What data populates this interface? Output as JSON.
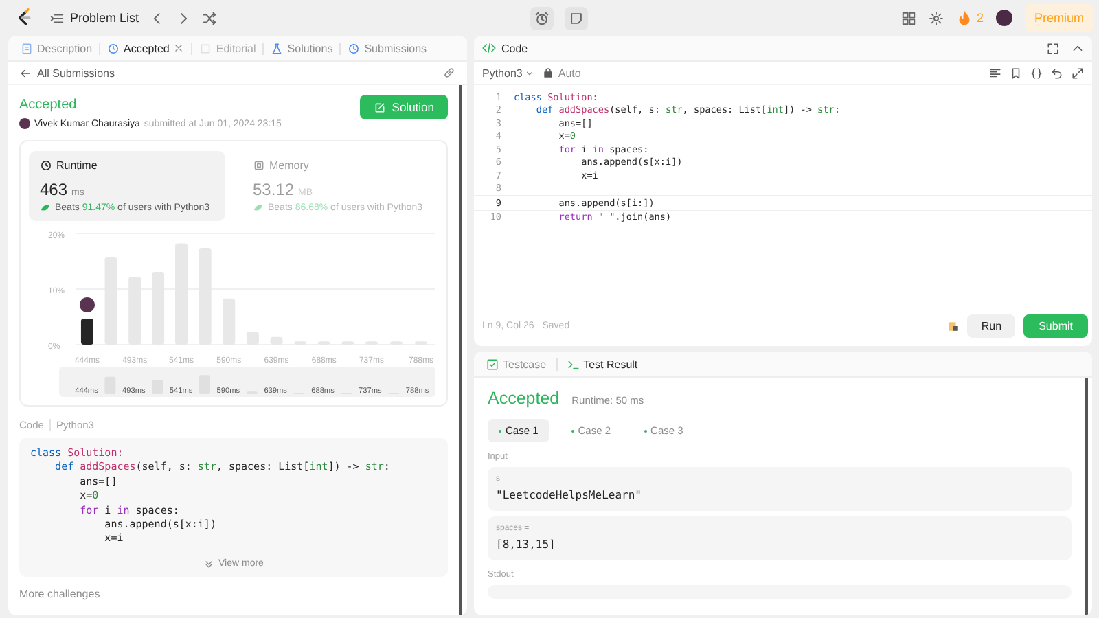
{
  "topbar": {
    "title": "Problem List",
    "streak": "2",
    "premium": "Premium"
  },
  "left_tabs": [
    {
      "label": "Description",
      "kind": "description",
      "selected": false,
      "disabled": false,
      "closable": false
    },
    {
      "label": "Accepted",
      "kind": "accepted",
      "selected": true,
      "disabled": false,
      "closable": true
    },
    {
      "label": "Editorial",
      "kind": "editorial",
      "selected": false,
      "disabled": true,
      "closable": false
    },
    {
      "label": "Solutions",
      "kind": "solutions",
      "selected": false,
      "disabled": false,
      "closable": false
    },
    {
      "label": "Submissions",
      "kind": "submissions",
      "selected": false,
      "disabled": false,
      "closable": false
    }
  ],
  "back_link": "All Submissions",
  "submission": {
    "status": "Accepted",
    "author": "Vivek Kumar Chaurasiya",
    "submitted": "submitted at Jun 01, 2024 23:15",
    "solution_button": "Solution"
  },
  "metrics": [
    {
      "kind": "runtime",
      "label": "Runtime",
      "value": "463",
      "unit": "ms",
      "beats_label": "Beats",
      "beats": "91.47%",
      "beats_suffix": "of users with Python3",
      "selected": true
    },
    {
      "kind": "memory",
      "label": "Memory",
      "value": "53.12",
      "unit": "MB",
      "beats_label": "Beats",
      "beats": "86.68%",
      "beats_suffix": "of users with Python3",
      "selected": false
    }
  ],
  "chart_data": {
    "type": "bar",
    "x": [
      444,
      468.5,
      493,
      517,
      541,
      565.5,
      590,
      614.5,
      639,
      663.5,
      688,
      712.5,
      737,
      762.5,
      788
    ],
    "xlim": [
      432,
      800
    ],
    "ylim": [
      0,
      20
    ],
    "yticks": [
      {
        "value": 0,
        "label": "0%"
      },
      {
        "value": 10,
        "label": "10%"
      },
      {
        "value": 20,
        "label": "20%"
      }
    ],
    "xticks": [
      {
        "value": 444,
        "label": "444ms"
      },
      {
        "value": 493,
        "label": "493ms"
      },
      {
        "value": 541,
        "label": "541ms"
      },
      {
        "value": 590,
        "label": "590ms"
      },
      {
        "value": 639,
        "label": "639ms"
      },
      {
        "value": 688,
        "label": "688ms"
      },
      {
        "value": 737,
        "label": "737ms"
      },
      {
        "value": 788,
        "label": "788ms"
      }
    ],
    "series": [
      {
        "color": "#262626",
        "values": [
          4.7,
          null,
          null,
          null,
          null,
          null,
          null,
          null,
          null,
          null,
          null,
          null,
          null,
          null,
          null
        ]
      },
      {
        "color": "#e8e8e8",
        "values": [
          null,
          15.8,
          12.2,
          13.1,
          18.2,
          17.4,
          8.3,
          2.3,
          1.4,
          0.6,
          0.6,
          0.6,
          0.6,
          0.6,
          0.6
        ]
      }
    ]
  },
  "overview_labels": [
    "444ms",
    "493ms",
    "541ms",
    "590ms",
    "639ms",
    "688ms",
    "737ms",
    "788ms"
  ],
  "code_preview": {
    "label": "Code",
    "language": "Python3",
    "view_more": "View more",
    "lines": [
      [
        {
          "text": "class ",
          "kind": "kw"
        },
        {
          "text": "Solution:",
          "kind": "name"
        }
      ],
      [
        {
          "text": "    def ",
          "kind": "kw"
        },
        {
          "text": "addSpaces",
          "kind": "name"
        },
        {
          "text": "(self, s: ",
          "kind": "plain"
        },
        {
          "text": "str",
          "kind": "type"
        },
        {
          "text": ", spaces: List[",
          "kind": "plain"
        },
        {
          "text": "int",
          "kind": "type"
        },
        {
          "text": "]) -> ",
          "kind": "plain"
        },
        {
          "text": "str",
          "kind": "type"
        },
        {
          "text": ":",
          "kind": "plain"
        }
      ],
      [
        {
          "text": "        ans=[]",
          "kind": "plain"
        }
      ],
      [
        {
          "text": "        x=",
          "kind": "plain"
        },
        {
          "text": "0",
          "kind": "num"
        }
      ],
      [
        {
          "text": "        for",
          "kind": "ctrl"
        },
        {
          "text": " i ",
          "kind": "plain"
        },
        {
          "text": "in",
          "kind": "ctrl"
        },
        {
          "text": " spaces:",
          "kind": "plain"
        }
      ],
      [
        {
          "text": "            ans.append(s[x:i])",
          "kind": "plain"
        }
      ],
      [
        {
          "text": "            x=i",
          "kind": "plain"
        }
      ]
    ]
  },
  "more_challenges": "More challenges",
  "editor": {
    "title": "Code",
    "language": "Python3",
    "mode": "Auto",
    "cursor": "Ln 9, Col 26",
    "saved": "Saved",
    "run": "Run",
    "submit": "Submit",
    "lines": [
      {
        "number": "1",
        "current": false,
        "tokens": [
          {
            "text": "class ",
            "kind": "kw"
          },
          {
            "text": "Solution:",
            "kind": "name"
          }
        ]
      },
      {
        "number": "2",
        "current": false,
        "tokens": [
          {
            "text": "    def ",
            "kind": "kw"
          },
          {
            "text": "addSpaces",
            "kind": "name"
          },
          {
            "text": "(self, s: ",
            "kind": "plain"
          },
          {
            "text": "str",
            "kind": "type"
          },
          {
            "text": ", spaces: List[",
            "kind": "plain"
          },
          {
            "text": "int",
            "kind": "type"
          },
          {
            "text": "]) -> ",
            "kind": "plain"
          },
          {
            "text": "str",
            "kind": "type"
          },
          {
            "text": ":",
            "kind": "plain"
          }
        ]
      },
      {
        "number": "3",
        "current": false,
        "tokens": [
          {
            "text": "        ans=[]",
            "kind": "plain"
          }
        ]
      },
      {
        "number": "4",
        "current": false,
        "tokens": [
          {
            "text": "        x=",
            "kind": "plain"
          },
          {
            "text": "0",
            "kind": "num"
          }
        ]
      },
      {
        "number": "5",
        "current": false,
        "tokens": [
          {
            "text": "        for",
            "kind": "ctrl"
          },
          {
            "text": " i ",
            "kind": "plain"
          },
          {
            "text": "in",
            "kind": "ctrl"
          },
          {
            "text": " spaces:",
            "kind": "plain"
          }
        ]
      },
      {
        "number": "6",
        "current": false,
        "tokens": [
          {
            "text": "            ans.append(s[x:i])",
            "kind": "plain"
          }
        ]
      },
      {
        "number": "7",
        "current": false,
        "tokens": [
          {
            "text": "            x=i",
            "kind": "plain"
          }
        ]
      },
      {
        "number": "8",
        "current": false
      },
      {
        "number": "9",
        "current": true,
        "tokens": [
          {
            "text": "        ans.append(s[i:])",
            "kind": "plain"
          }
        ]
      },
      {
        "number": "10",
        "current": false,
        "tokens": [
          {
            "text": "        return",
            "kind": "ctrl"
          },
          {
            "text": " \" \".join(ans)",
            "kind": "plain"
          }
        ]
      }
    ]
  },
  "result_tabs": [
    {
      "label": "Testcase",
      "kind": "testcase",
      "selected": false
    },
    {
      "label": "Test Result",
      "kind": "result",
      "selected": true
    }
  ],
  "result": {
    "status": "Accepted",
    "runtime": "Runtime: 50 ms"
  },
  "cases": [
    {
      "label": "Case 1",
      "selected": true
    },
    {
      "label": "Case 2",
      "selected": false
    },
    {
      "label": "Case 3",
      "selected": false
    }
  ],
  "input_label": "Input",
  "inputs": [
    {
      "name": "s =",
      "value": "\"LeetcodeHelpsMeLearn\""
    },
    {
      "name": "spaces =",
      "value": "[8,13,15]"
    }
  ],
  "stdout_label": "Stdout"
}
